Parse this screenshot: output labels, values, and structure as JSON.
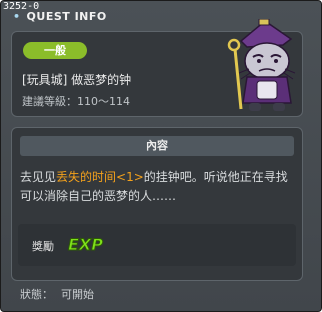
{
  "window": {
    "quest_id": "3252-0",
    "title": "QUEST INFO"
  },
  "summary": {
    "category_badge": "一般",
    "quest_name": "[玩具城] 做恶梦的钟",
    "level_label": "建議等級：",
    "level_range": "110～114"
  },
  "content": {
    "header": "內容",
    "desc_before": "去见见",
    "desc_highlight": "丢失的时间<1>",
    "desc_after": "的挂钟吧。听说他正在寻找可以消除自己的恶梦的人……"
  },
  "reward": {
    "label": "獎勵",
    "exp_icon_text": "EXP"
  },
  "status": {
    "label": "狀態：",
    "value": "可開始"
  },
  "colors": {
    "badge_green": "#8bbd2a",
    "highlight_orange": "#f3a11c",
    "exp_green": "#7fe21a"
  },
  "icons": {
    "npc": "clock-npc-icon",
    "exp": "exp-icon"
  }
}
